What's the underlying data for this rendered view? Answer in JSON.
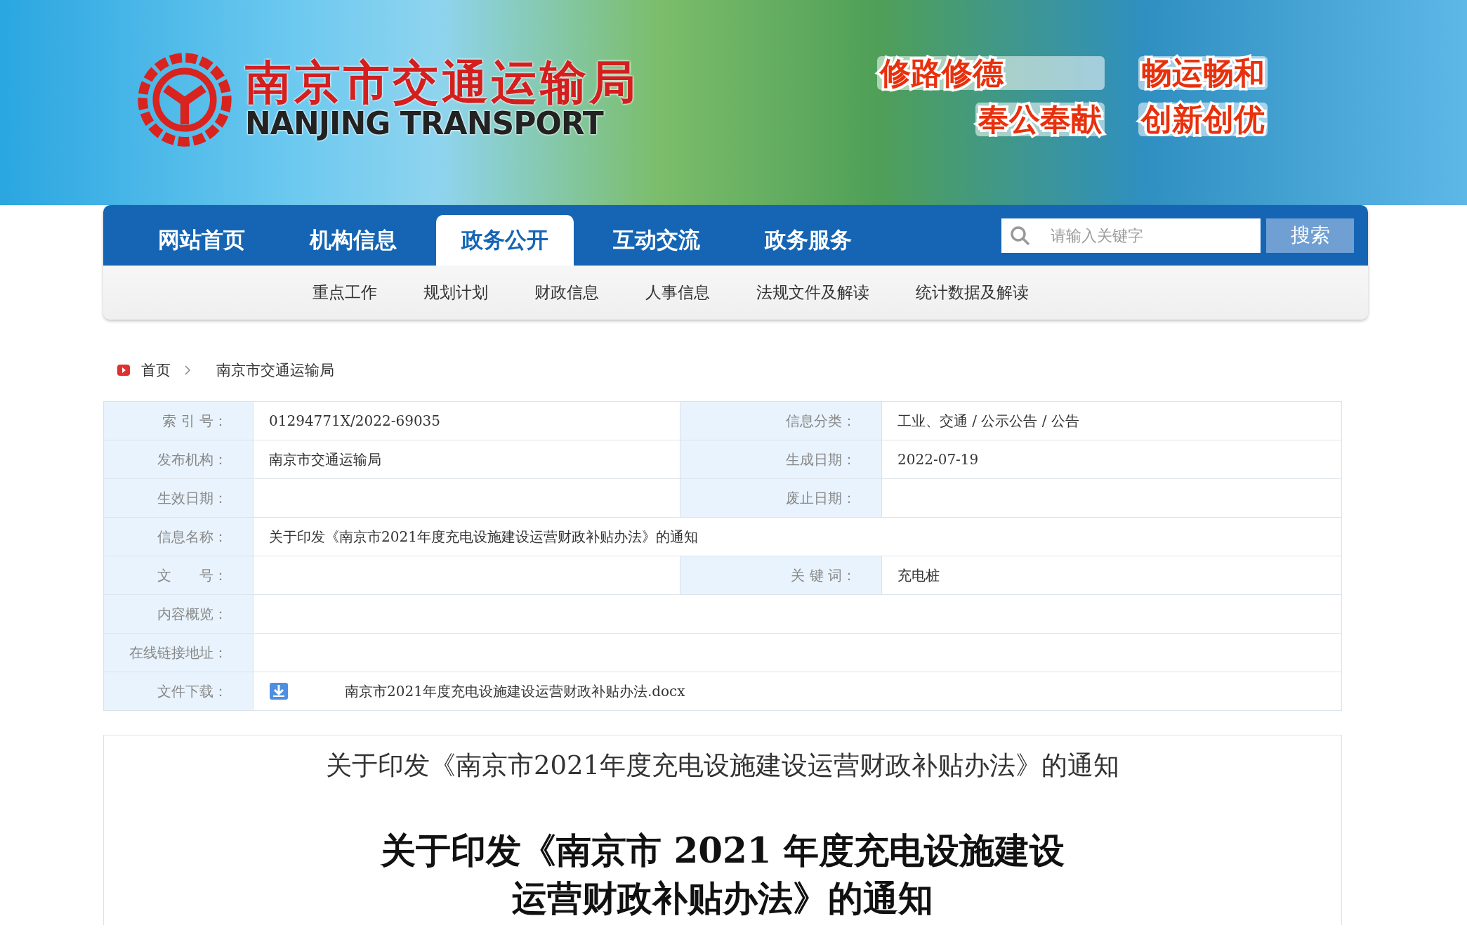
{
  "header": {
    "logo_cn": "南京市交通运输局",
    "logo_en": "NANJING TRANSPORT",
    "slogans": [
      "修路修德",
      "畅运畅和",
      "奉公奉献",
      "创新创优"
    ]
  },
  "nav": {
    "items": [
      {
        "label": "网站首页",
        "selected": false
      },
      {
        "label": "机构信息",
        "selected": false
      },
      {
        "label": "政务公开",
        "selected": true
      },
      {
        "label": "互动交流",
        "selected": false
      },
      {
        "label": "政务服务",
        "selected": false
      }
    ],
    "search": {
      "placeholder": "请输入关键字",
      "button": "搜索"
    }
  },
  "subnav": [
    "重点工作",
    "规划计划",
    "财政信息",
    "人事信息",
    "法规文件及解读",
    "统计数据及解读"
  ],
  "breadcrumb": [
    "首页",
    "南京市交通运输局"
  ],
  "info_table": {
    "rows": [
      {
        "kind": "pair",
        "cells": [
          {
            "label": "索 引 号：",
            "value": "01294771X/2022-69035"
          },
          {
            "label": "信息分类：",
            "value": "工业、交通 / 公示公告 / 公告"
          }
        ]
      },
      {
        "kind": "pair",
        "cells": [
          {
            "label": "发布机构：",
            "value": "南京市交通运输局"
          },
          {
            "label": "生成日期：",
            "value": "2022-07-19"
          }
        ]
      },
      {
        "kind": "pair",
        "cells": [
          {
            "label": "生效日期："
          },
          {
            "label": "废止日期："
          }
        ]
      },
      {
        "kind": "single",
        "cells": [
          {
            "label": "信息名称：",
            "value": "关于印发《南京市2021年度充电设施建设运营财政补贴办法》的通知"
          }
        ]
      },
      {
        "kind": "pair",
        "cells": [
          {
            "label": "文　　号："
          },
          {
            "label": "关 键 词：",
            "value": "充电桩"
          }
        ]
      },
      {
        "kind": "single",
        "cells": [
          {
            "label": "内容概览："
          }
        ]
      },
      {
        "kind": "single",
        "cells": [
          {
            "label": "在线链接地址："
          }
        ]
      },
      {
        "kind": "download",
        "cells": [
          {
            "label": "文件下载：",
            "value": "南京市2021年度充电设施建设运营财政补贴办法.docx"
          }
        ]
      }
    ]
  },
  "article": {
    "title": "关于印发《南京市2021年度充电设施建设运营财政补贴办法》的通知",
    "heading": [
      "关于印发《南京市 2021 年度充电设施建设",
      "运营财政补贴办法》的通知"
    ]
  }
}
